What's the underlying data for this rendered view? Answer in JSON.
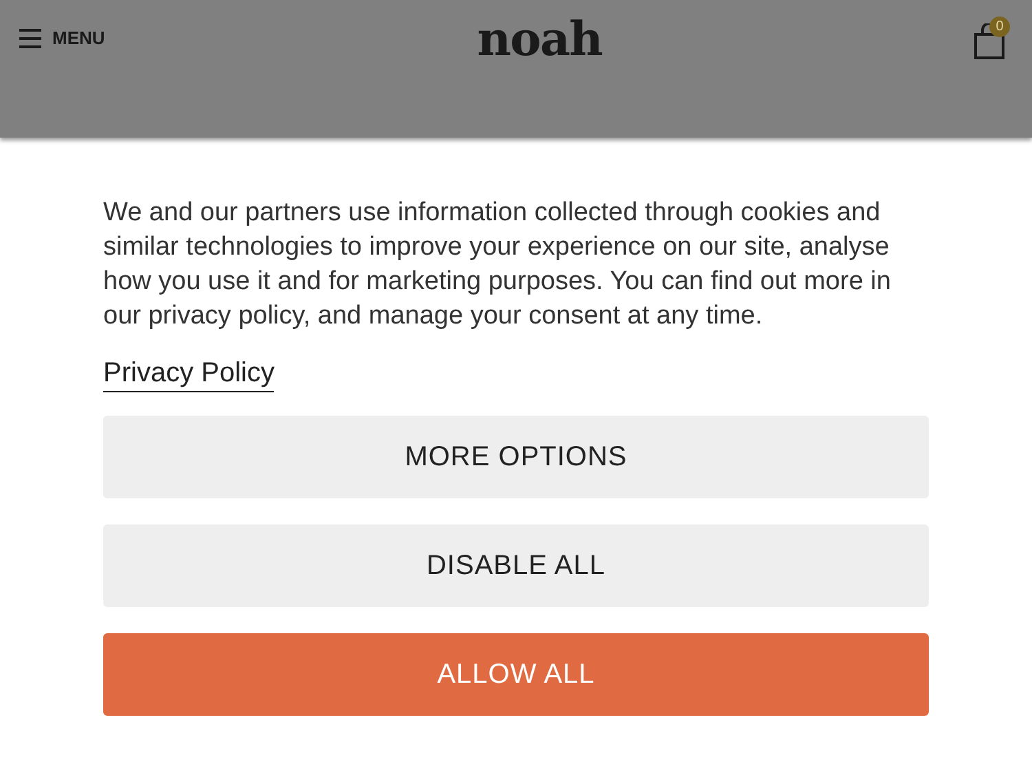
{
  "header": {
    "menu_label": "MENU",
    "logo": "noah",
    "cart_count": "0"
  },
  "consent": {
    "text": "We and our partners use information collected through cookies and similar technologies to improve your experience on our site, analyse how you use it and for marketing purposes. You can find out more in our privacy policy, and manage your consent at any time.",
    "link": "Privacy Policy",
    "buttons": [
      {
        "label": "MORE OPTIONS",
        "kind": "secondary"
      },
      {
        "label": "DISABLE ALL",
        "kind": "secondary"
      },
      {
        "label": "ALLOW ALL",
        "kind": "primary"
      }
    ]
  }
}
